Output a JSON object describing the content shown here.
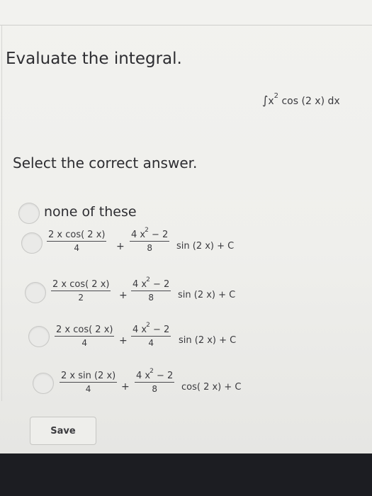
{
  "question": {
    "heading": "Evaluate the integral.",
    "integral_symbol": "∫",
    "integrand_var": "x",
    "integrand_exp": "2",
    "integrand_rest": "cos (2 x)  dx",
    "prompt": "Select the correct answer."
  },
  "choices": [
    {
      "text": "none of these"
    },
    {
      "frac1_num": "2 x cos( 2 x)",
      "frac1_den": "4",
      "plus": "+",
      "frac2_num_base": "4 x",
      "frac2_num_exp": "2",
      "frac2_num_rest": " − 2",
      "frac2_den": "8",
      "tail": "sin (2 x) + C"
    },
    {
      "frac1_num": "2 x cos( 2 x)",
      "frac1_den": "2",
      "plus": "+",
      "frac2_num_base": "4 x",
      "frac2_num_exp": "2",
      "frac2_num_rest": " − 2",
      "frac2_den": "8",
      "tail": "sin (2 x) + C"
    },
    {
      "frac1_num": "2 x cos( 2 x)",
      "frac1_den": "4",
      "plus": "+",
      "frac2_num_base": "4 x",
      "frac2_num_exp": "2",
      "frac2_num_rest": " − 2",
      "frac2_den": "4",
      "tail": "sin (2 x) + C"
    },
    {
      "frac1_num": "2 x sin (2 x)",
      "frac1_den": "4",
      "plus": "+",
      "frac2_num_base": "4 x",
      "frac2_num_exp": "2",
      "frac2_num_rest": " − 2",
      "frac2_den": "8",
      "tail": "cos( 2 x) + C"
    }
  ],
  "actions": {
    "save_label": "Save"
  }
}
